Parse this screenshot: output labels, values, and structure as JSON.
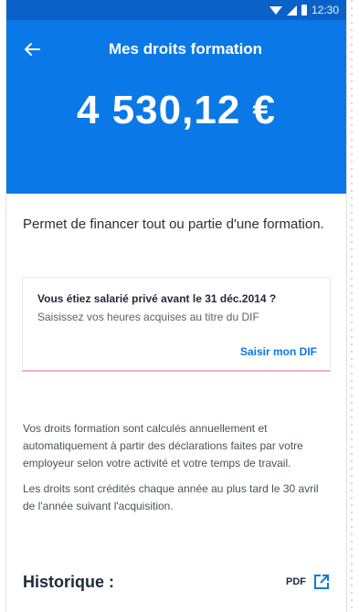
{
  "status_bar": {
    "time": "12:30"
  },
  "header": {
    "back_icon": "arrow-left-icon",
    "title": "Mes droits formation"
  },
  "balance": {
    "amount": "4 530,12 €"
  },
  "description": "Permet de financer tout ou partie d'une formation.",
  "dif_card": {
    "question": "Vous étiez salarié privé avant le 31 déc.2014 ?",
    "hint": "Saisissez vos heures acquises au titre du DIF",
    "link_label": "Saisir mon DIF"
  },
  "info": {
    "paragraph_1": "Vos droits formation sont calculés annuellement et automatiquement à partir des déclarations faites par votre employeur selon votre activité et votre temps de travail.",
    "paragraph_2": "Les droits sont crédités chaque année au plus tard le 30 avril de l'année suivant l'acquisition."
  },
  "history": {
    "title": "Historique :",
    "pdf_label": "PDF",
    "pdf_icon": "external-link-icon"
  },
  "colors": {
    "primary": "#0a78e6",
    "status_bar": "#0a62c8",
    "card_accent": "#f3b3ba"
  }
}
